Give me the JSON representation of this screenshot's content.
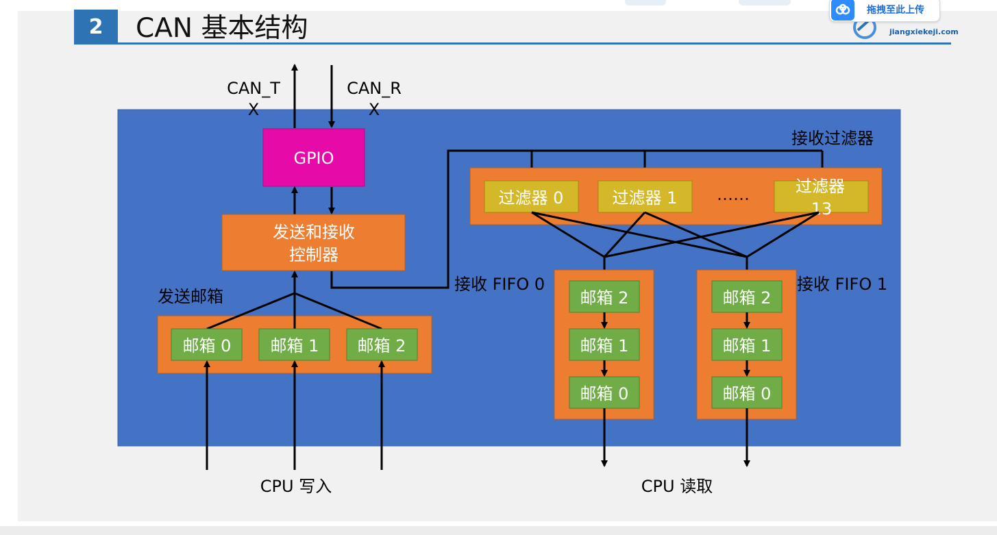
{
  "header": {
    "section_number": "2",
    "title": "CAN 基本结构"
  },
  "brand": {
    "logo_text": "jiangxiekeji.com"
  },
  "toolbar": {
    "upload_label": "拖拽至此上传"
  },
  "diagram": {
    "can_tx": "CAN_T",
    "can_tx_suffix": "X",
    "can_rx": "CAN_R",
    "can_rx_suffix": "X",
    "gpio": "GPIO",
    "controller_line1": "发送和接收",
    "controller_line2": "控制器",
    "tx_mailboxes_label": "发送邮箱",
    "tx_mailboxes": [
      "邮箱 0",
      "邮箱 1",
      "邮箱 2"
    ],
    "filters_label": "接收过滤器",
    "filters": [
      "过滤器 0",
      "过滤器 1",
      "过滤器"
    ],
    "filter_last_number": "13",
    "filter_ellipsis": "……",
    "fifo0_label": "接收 FIFO 0",
    "fifo1_label": "接收 FIFO 1",
    "fifo_mailboxes": [
      "邮箱 2",
      "邮箱 1",
      "邮箱 0"
    ],
    "cpu_write": "CPU 写入",
    "cpu_read": "CPU 读取"
  },
  "colors": {
    "panel": "#4472c4",
    "orange": "#ed7d31",
    "green": "#70ad47",
    "gold": "#d4b829",
    "gpio": "#e60aa8",
    "accent": "#2e74b5"
  }
}
